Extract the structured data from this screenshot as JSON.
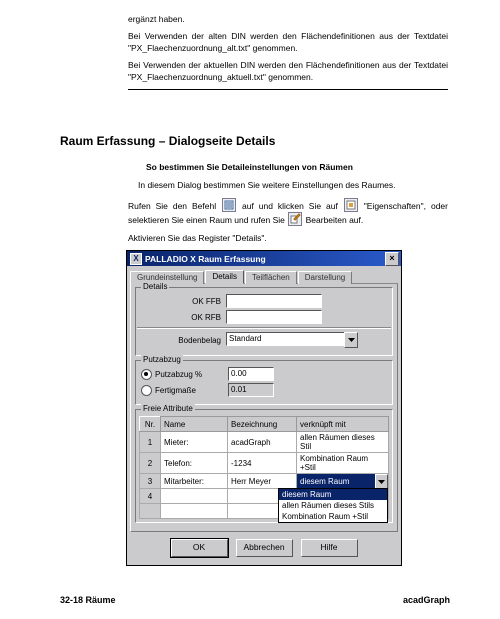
{
  "intro": {
    "p0": "ergänzt haben.",
    "p1": "Bei Verwenden der alten DIN werden den Flächendefinitionen aus der Textdatei \"PX_Flaechenzuordnung_alt.txt\" genommen.",
    "p2": "Bei Verwenden der aktuellen DIN werden den Flächendefinitionen aus der Textdatei \"PX_Flaechenzuordnung_aktuell.txt\" genommen."
  },
  "section_title": "Raum Erfassung  – Dialogseite Details",
  "subhead": "So bestimmen Sie Detaileinstellungen von Räumen",
  "line1": "In diesem Dialog bestimmen Sie weitere Einstellungen des Raumes.",
  "line2a": "Rufen Sie den Befehl ",
  "line2b": " auf und klicken Sie auf ",
  "line2c": " \"Eigenschaften\", oder selektieren Sie einen Raum und rufen Sie ",
  "line2d": " Bearbeiten auf.",
  "line3": "Aktivieren Sie das Register \"Details\".",
  "dialog": {
    "title": "PALLADIO X  Raum Erfassung",
    "app_icon_letter": "X",
    "tabs": [
      "Grundeinstellung",
      "Details",
      "Teilflächen",
      "Darstellung"
    ],
    "active_tab": 1,
    "group1": {
      "legend": "Details",
      "ok_ffb_label": "OK FFB",
      "ok_ffb_value": "",
      "ok_rfb_label": "OK RFB",
      "ok_rfb_value": "",
      "boden_label": "Bodenbelag",
      "boden_value": "Standard"
    },
    "group2": {
      "legend": "Putzabzug",
      "r1_label": "Putzabzug %",
      "r1_value": "0.00",
      "r2_label": "Fertigmaße",
      "r2_value": "0.01"
    },
    "table": {
      "legend": "Freie Attribute",
      "headers": [
        "Nr.",
        "Name",
        "Bezeichnung",
        "verknüpft mit"
      ],
      "rows": [
        {
          "nr": "1",
          "name": "Mieter:",
          "bez": "acadGraph",
          "ver": "allen Räumen dieses Stil"
        },
        {
          "nr": "2",
          "name": "Telefon:",
          "bez": "-1234",
          "ver": "Kombination Raum +Stil"
        },
        {
          "nr": "3",
          "name": "Mitarbeiter:",
          "bez": "Herr Meyer",
          "ver": "diesem Raum"
        },
        {
          "nr": "4",
          "name": "",
          "bez": "",
          "ver": ""
        }
      ],
      "dropdown_options": [
        "diesem Raum",
        "allen Räumen dieses Stils",
        "Kombination Raum +Stil"
      ]
    },
    "buttons": {
      "ok": "OK",
      "cancel": "Abbrechen",
      "help": "Hilfe"
    }
  },
  "footer": {
    "left": "32-18 Räume",
    "right": "acadGraph"
  }
}
